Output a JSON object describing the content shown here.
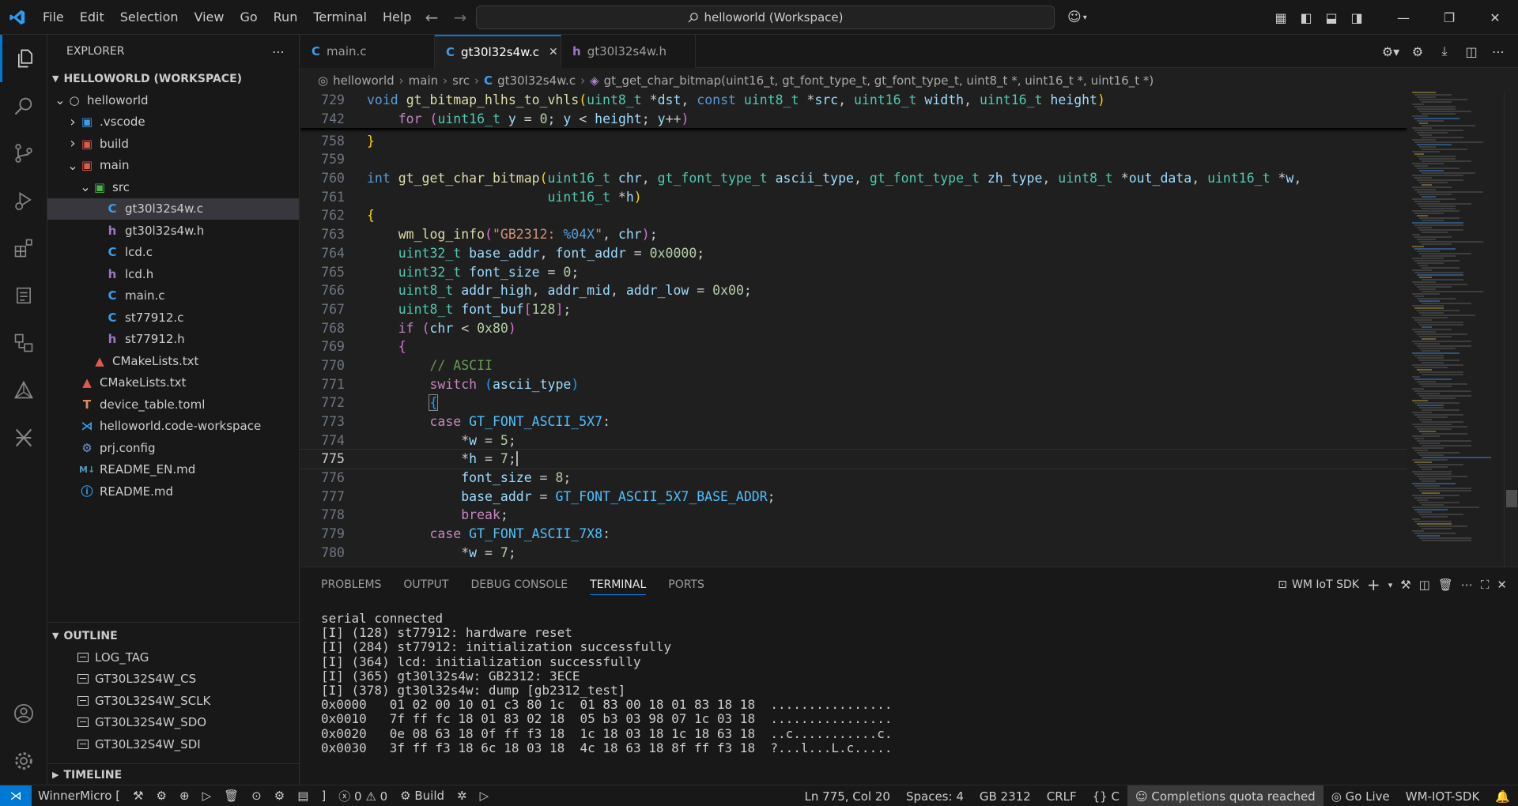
{
  "titlebar": {
    "menu": [
      "File",
      "Edit",
      "Selection",
      "View",
      "Go",
      "Run",
      "Terminal",
      "Help"
    ],
    "search": "helloworld (Workspace)"
  },
  "explorer": {
    "header": "EXPLORER",
    "workspace": "HELLOWORLD (WORKSPACE)",
    "items": [
      {
        "label": "helloworld",
        "icon": "circle",
        "chev": "v",
        "indent": 16,
        "color": "#cccccc",
        "sel": false
      },
      {
        "label": ".vscode",
        "icon": "folder-vscode",
        "chev": ">",
        "indent": 32,
        "color": "#3b9de8",
        "sel": false
      },
      {
        "label": "build",
        "icon": "folder-build",
        "chev": ">",
        "indent": 32,
        "color": "#e05b4b",
        "sel": false
      },
      {
        "label": "main",
        "icon": "folder-main",
        "chev": "v",
        "indent": 32,
        "color": "#e05b4b",
        "sel": false
      },
      {
        "label": "src",
        "icon": "folder-src",
        "chev": "v",
        "indent": 48,
        "color": "#4caf50",
        "sel": false
      },
      {
        "label": "gt30l32s4w.c",
        "icon": "c-file",
        "chev": "",
        "indent": 64,
        "color": "#3b9de8",
        "sel": true
      },
      {
        "label": "gt30l32s4w.h",
        "icon": "h-file",
        "chev": "",
        "indent": 64,
        "color": "#a074c4",
        "sel": false
      },
      {
        "label": "lcd.c",
        "icon": "c-file",
        "chev": "",
        "indent": 64,
        "color": "#3b9de8",
        "sel": false
      },
      {
        "label": "lcd.h",
        "icon": "h-file",
        "chev": "",
        "indent": 64,
        "color": "#a074c4",
        "sel": false
      },
      {
        "label": "main.c",
        "icon": "c-file",
        "chev": "",
        "indent": 64,
        "color": "#3b9de8",
        "sel": false
      },
      {
        "label": "st77912.c",
        "icon": "c-file",
        "chev": "",
        "indent": 64,
        "color": "#3b9de8",
        "sel": false
      },
      {
        "label": "st77912.h",
        "icon": "h-file",
        "chev": "",
        "indent": 64,
        "color": "#a074c4",
        "sel": false
      },
      {
        "label": "CMakeLists.txt",
        "icon": "cmake",
        "chev": "",
        "indent": 48,
        "color": "#e05b4b",
        "sel": false
      },
      {
        "label": "CMakeLists.txt",
        "icon": "cmake",
        "chev": "",
        "indent": 32,
        "color": "#e05b4b",
        "sel": false
      },
      {
        "label": "device_table.toml",
        "icon": "toml",
        "chev": "",
        "indent": 32,
        "color": "#e08a5b",
        "sel": false
      },
      {
        "label": "helloworld.code-workspace",
        "icon": "vscode",
        "chev": "",
        "indent": 32,
        "color": "#3b9de8",
        "sel": false
      },
      {
        "label": "prj.config",
        "icon": "gear",
        "chev": "",
        "indent": 32,
        "color": "#6c9bd2",
        "sel": false
      },
      {
        "label": "README_EN.md",
        "icon": "markdown",
        "chev": "",
        "indent": 32,
        "color": "#519aba",
        "sel": false
      },
      {
        "label": "README.md",
        "icon": "info",
        "chev": "",
        "indent": 32,
        "color": "#3b9de8",
        "sel": false
      }
    ]
  },
  "outline": {
    "header": "OUTLINE",
    "items": [
      "LOG_TAG",
      "GT30L32S4W_CS",
      "GT30L32S4W_SCLK",
      "GT30L32S4W_SDO",
      "GT30L32S4W_SDI"
    ]
  },
  "timeline": {
    "header": "TIMELINE"
  },
  "tabs": [
    {
      "label": "main.c",
      "icon": "C",
      "color": "#3b9de8",
      "active": false
    },
    {
      "label": "gt30l32s4w.c",
      "icon": "C",
      "color": "#3b9de8",
      "active": true
    },
    {
      "label": "gt30l32s4w.h",
      "icon": "h",
      "color": "#a074c4",
      "active": false
    }
  ],
  "breadcrumb": [
    "helloworld",
    "main",
    "src",
    "gt30l32s4w.c",
    "gt_get_char_bitmap(uint16_t, gt_font_type_t, gt_font_type_t, uint8_t *, uint16_t *, uint16_t *)"
  ],
  "editor": {
    "sticky": [
      {
        "n": "729",
        "html": "<span class='k'>void</span> <span class='fn'>gt_bitmap_hlhs_to_vhls</span><span class='p'>(</span><span class='ty'>uint8_t</span> *<span class='v'>dst</span>, <span class='k'>const</span> <span class='ty'>uint8_t</span> *<span class='v'>src</span>, <span class='ty'>uint16_t</span> <span class='v'>width</span>, <span class='ty'>uint16_t</span> <span class='v'>height</span><span class='p'>)</span>"
      },
      {
        "n": "742",
        "html": "    <span class='ct'>for</span> <span class='p2'>(</span><span class='ty'>uint16_t</span> <span class='v'>y</span> = <span class='n'>0</span>; <span class='v'>y</span> &lt; <span class='v'>height</span>; <span class='v'>y</span>++<span class='p2'>)</span>"
      }
    ],
    "lines": [
      {
        "n": "758",
        "html": "<span class='p'>}</span>"
      },
      {
        "n": "759",
        "html": ""
      },
      {
        "n": "760",
        "html": "<span class='k'>int</span> <span class='fn'>gt_get_char_bitmap</span><span class='p'>(</span><span class='ty'>uint16_t</span> <span class='v'>chr</span>, <span class='ty'>gt_font_type_t</span> <span class='v'>ascii_type</span>, <span class='ty'>gt_font_type_t</span> <span class='v'>zh_type</span>, <span class='ty'>uint8_t</span> *<span class='v'>out_data</span>, <span class='ty'>uint16_t</span> *<span class='v'>w</span>,"
      },
      {
        "n": "761",
        "html": "                       <span class='ty'>uint16_t</span> *<span class='v'>h</span><span class='p'>)</span>"
      },
      {
        "n": "762",
        "html": "<span class='p'>{</span>"
      },
      {
        "n": "763",
        "html": "    <span class='fn'>wm_log_info</span><span class='p2'>(</span><span class='s'>\"GB2312: </span><span class='k'>%04X</span><span class='s'>\"</span>, <span class='v'>chr</span><span class='p2'>)</span>;"
      },
      {
        "n": "764",
        "html": "    <span class='ty'>uint32_t</span> <span class='v'>base_addr</span>, <span class='v'>font_addr</span> = <span class='n'>0x0000</span>;"
      },
      {
        "n": "765",
        "html": "    <span class='ty'>uint32_t</span> <span class='v'>font_size</span> = <span class='n'>0</span>;"
      },
      {
        "n": "766",
        "html": "    <span class='ty'>uint8_t</span> <span class='v'>addr_high</span>, <span class='v'>addr_mid</span>, <span class='v'>addr_low</span> = <span class='n'>0x00</span>;"
      },
      {
        "n": "767",
        "html": "    <span class='ty'>uint8_t</span> <span class='v'>font_buf</span><span class='p2'>[</span><span class='n'>128</span><span class='p2'>]</span>;"
      },
      {
        "n": "768",
        "html": "    <span class='ct'>if</span> <span class='p2'>(</span><span class='v'>chr</span> &lt; <span class='n'>0x80</span><span class='p2'>)</span>"
      },
      {
        "n": "769",
        "html": "    <span class='p2'>{</span>"
      },
      {
        "n": "770",
        "html": "        <span class='cm'>// ASCII</span>"
      },
      {
        "n": "771",
        "html": "        <span class='ct'>switch</span> <span class='p3'>(</span><span class='v'>ascii_type</span><span class='p3'>)</span>"
      },
      {
        "n": "772",
        "html": "        <span class='p3' style='outline:1px solid #888'>{</span>"
      },
      {
        "n": "773",
        "html": "        <span class='ct'>case</span> <span class='mc'>GT_FONT_ASCII_5X7</span>:"
      },
      {
        "n": "774",
        "html": "            *<span class='v'>w</span> = <span class='n'>5</span>;"
      },
      {
        "n": "775",
        "html": "            *<span class='v'>h</span> = <span class='n'>7</span>;<span style='border-left:2px solid #aeafad'></span>",
        "current": true
      },
      {
        "n": "776",
        "html": "            <span class='v'>font_size</span> = <span class='n'>8</span>;"
      },
      {
        "n": "777",
        "html": "            <span class='v'>base_addr</span> = <span class='mc'>GT_FONT_ASCII_5X7_BASE_ADDR</span>;"
      },
      {
        "n": "778",
        "html": "            <span class='ct'>break</span>;"
      },
      {
        "n": "779",
        "html": "        <span class='ct'>case</span> <span class='mc'>GT_FONT_ASCII_7X8</span>:"
      },
      {
        "n": "780",
        "html": "            *<span class='v'>w</span> = <span class='n'>7</span>;"
      }
    ]
  },
  "panel": {
    "tabs": [
      "PROBLEMS",
      "OUTPUT",
      "DEBUG CONSOLE",
      "TERMINAL",
      "PORTS"
    ],
    "active_tab": "TERMINAL",
    "terminal_name": "WM IoT SDK",
    "terminal_lines": [
      "serial connected",
      "[I] (128) st77912: hardware reset",
      "[I] (284) st77912: initialization successfully",
      "[I] (364) lcd: initialization successfully",
      "[I] (365) gt30l32s4w: GB2312: 3ECE",
      "[I] (378) gt30l32s4w: dump [gb2312_test]",
      "0x0000   01 02 00 10 01 c3 80 1c  01 83 00 18 01 83 18 18  ................",
      "0x0010   7f ff fc 18 01 83 02 18  05 b3 03 98 07 1c 03 18  ................",
      "0x0020   0e 08 63 18 0f ff f3 18  1c 18 03 18 1c 18 63 18  ..c...........c.",
      "0x0030   3f ff f3 18 6c 18 03 18  4c 18 63 18 8f ff f3 18  ?...l...L.c....."
    ]
  },
  "statusbar": {
    "target": "WinnerMicro [",
    "bracket": "]",
    "errors": "0",
    "warnings": "0",
    "build": "Build",
    "position": "Ln 775, Col 20",
    "spaces": "Spaces: 4",
    "encoding": "GB 2312",
    "eol": "CRLF",
    "language": "C",
    "quota": "Completions quota reached",
    "golive": "Go Live",
    "sdk": "WM-IOT-SDK"
  }
}
